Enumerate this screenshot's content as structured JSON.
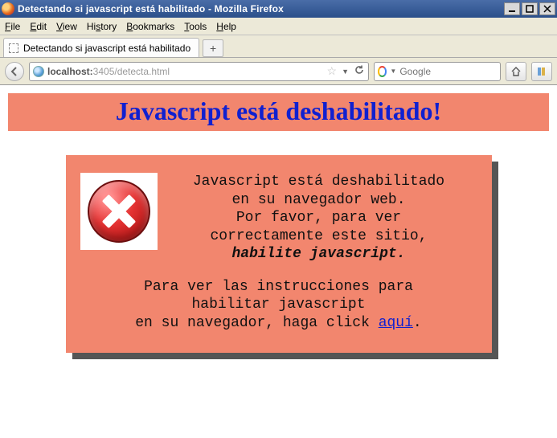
{
  "window": {
    "title": "Detectando si javascript está habilitado - Mozilla Firefox"
  },
  "menu": {
    "file": "File",
    "edit": "Edit",
    "view": "View",
    "history": "History",
    "bookmarks": "Bookmarks",
    "tools": "Tools",
    "help": "Help"
  },
  "tab": {
    "title": "Detectando si javascript está habilitado",
    "newtab_label": "+"
  },
  "url": {
    "host": "localhost:",
    "path": "3405/detecta.html"
  },
  "search": {
    "placeholder": "Google"
  },
  "banner": {
    "heading": "Javascript está deshabilitado!"
  },
  "panel": {
    "line1": "Javascript está deshabilitado",
    "line2": "en su navegador web.",
    "line3": "Por favor, para ver",
    "line4": "correctamente este sitio,",
    "line5_emph": "habilite javascript.",
    "line6": "Para ver las instrucciones para",
    "line7": "habilitar javascript",
    "line8_pre": "en su navegador, haga click ",
    "link_text": "aquí",
    "line8_post": "."
  }
}
